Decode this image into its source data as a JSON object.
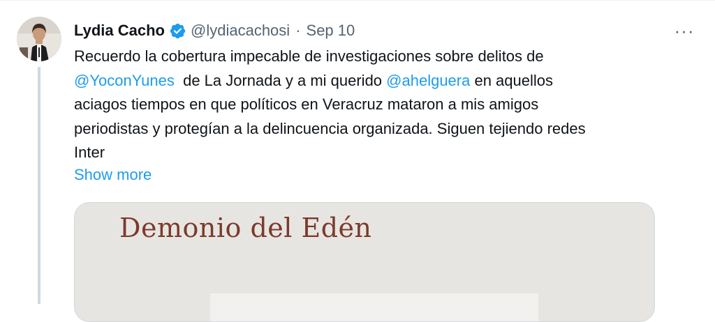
{
  "tweet": {
    "author": {
      "display_name": "Lydia Cacho",
      "handle": "@lydiacachosi",
      "verified": true
    },
    "separator": "·",
    "timestamp": "Sep 10",
    "more_label": "···",
    "text": {
      "line1": "Recuerdo la cobertura impecable de investigaciones sobre delitos de",
      "mention1": "@YoconYunes",
      "line2_middle": "  de La Jornada y a mi querido ",
      "mention2": "@ahelguera",
      "line2_end": " en aquellos",
      "line3": "aciagos tiempos en que políticos en Veracruz mataron a mis amigos",
      "line4": "periodistas y protegían a la delincuencia organizada. Siguen tejiendo redes",
      "line5": "Inter"
    },
    "show_more": "Show more",
    "media": {
      "title": "Demonio del Edén"
    }
  },
  "colors": {
    "link": "#1d9bf0",
    "secondary_text": "#536471",
    "verified_badge": "#1d9bf0",
    "thread_line": "#cfd9de",
    "media_title": "#7b3a2b"
  },
  "icons": {
    "verified": "verified-badge-icon",
    "more": "more-horizontal-icon"
  }
}
